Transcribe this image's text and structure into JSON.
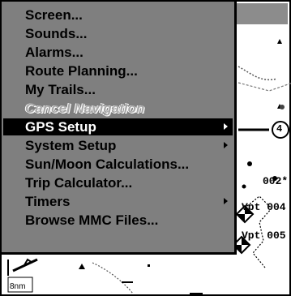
{
  "menu": {
    "items": [
      {
        "label": "Screen...",
        "submenu": false,
        "state": "normal"
      },
      {
        "label": "Sounds...",
        "submenu": false,
        "state": "normal"
      },
      {
        "label": "Alarms...",
        "submenu": false,
        "state": "normal"
      },
      {
        "label": "Route Planning...",
        "submenu": false,
        "state": "normal"
      },
      {
        "label": "My Trails...",
        "submenu": false,
        "state": "normal"
      },
      {
        "label": "Cancel Navigation",
        "submenu": false,
        "state": "disabled"
      },
      {
        "label": "GPS Setup",
        "submenu": true,
        "state": "selected"
      },
      {
        "label": "System Setup",
        "submenu": true,
        "state": "normal"
      },
      {
        "label": "Sun/Moon Calculations...",
        "submenu": false,
        "state": "normal"
      },
      {
        "label": "Trip Calculator...",
        "submenu": false,
        "state": "normal"
      },
      {
        "label": "Timers",
        "submenu": true,
        "state": "normal"
      },
      {
        "label": "Browse MMC Files...",
        "submenu": false,
        "state": "normal"
      }
    ]
  },
  "map": {
    "scale_label": "8nm",
    "waypoints": [
      "002*",
      "Vpt 004",
      "Vpt 005"
    ],
    "route_label": "4"
  },
  "colors": {
    "menu_bg": "#7f7f7f",
    "selected_bg": "#000000",
    "selected_fg": "#ffffff",
    "title_bar": "#8c8c8c"
  }
}
